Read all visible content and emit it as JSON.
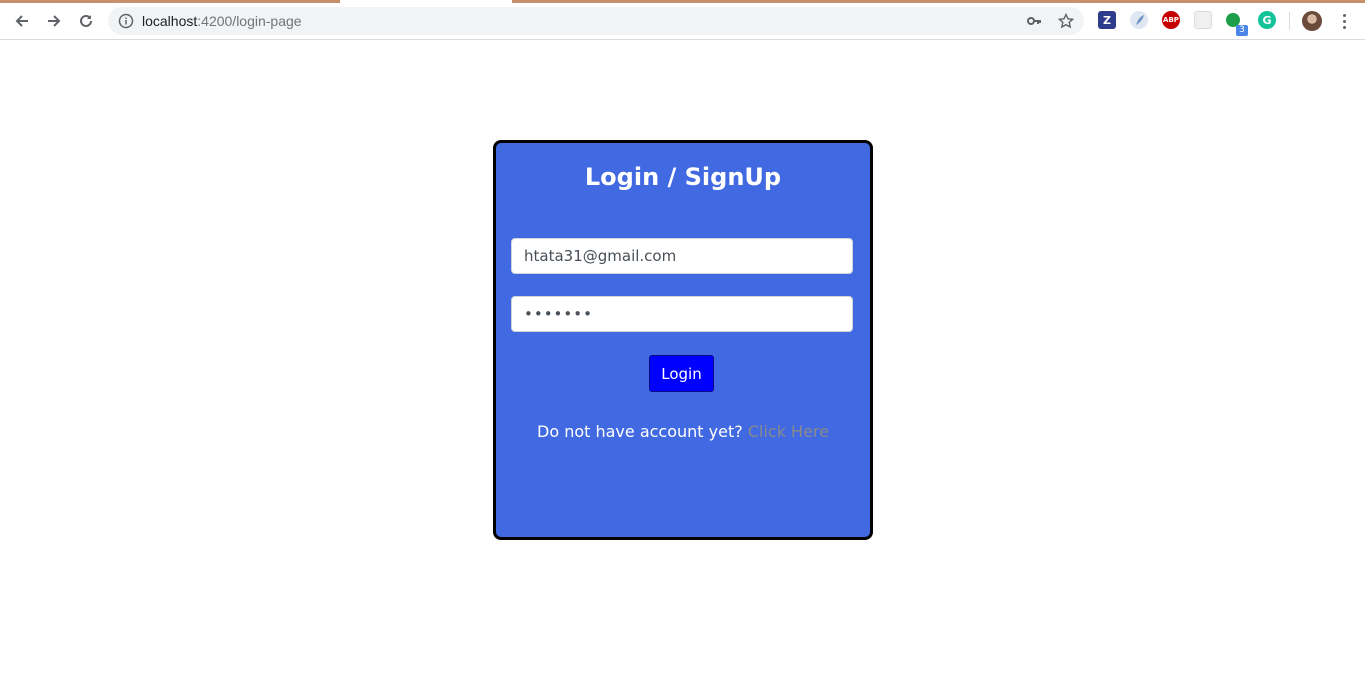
{
  "browser": {
    "url_host": "localhost",
    "url_path": ":4200/login-page",
    "extension_badge_count": "3",
    "extensions": [
      {
        "name": "zotero-icon",
        "label": "Z",
        "color": "#2e3c8c"
      },
      {
        "name": "feather-extension-icon",
        "label": "",
        "color": "#9bb4d6"
      },
      {
        "name": "adblock-plus-icon",
        "label": "ABP",
        "color": "#c60000"
      },
      {
        "name": "blank-extension-icon",
        "label": "",
        "color": "#e8e8e8"
      },
      {
        "name": "green-dot-extension-icon",
        "label": "",
        "color": "#1e9e4a"
      },
      {
        "name": "grammarly-icon",
        "label": "G",
        "color": "#15c39a"
      }
    ]
  },
  "login": {
    "title": "Login / SignUp",
    "email_value": "htata31@gmail.com",
    "password_value": "•••••••",
    "login_button_label": "Login",
    "signup_prompt": "Do not have account yet?",
    "signup_link_label": "Click Here"
  },
  "colors": {
    "card_background": "#4169e1",
    "login_button": "#0000ff",
    "link_text": "#8a8a8a",
    "tab_accent": "#c8906a"
  }
}
